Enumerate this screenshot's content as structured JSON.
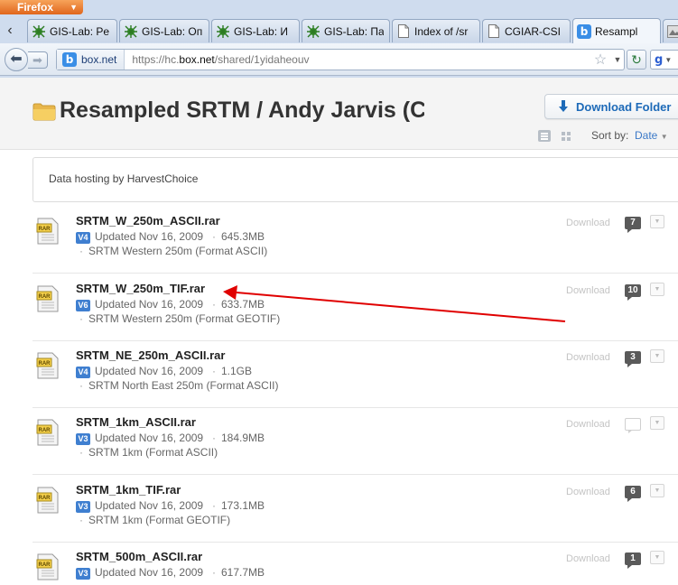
{
  "browser": {
    "app_button_label": "Firefox",
    "tabs": [
      {
        "title": "GIS-Lab: Pe",
        "icon": "gis-lab-favicon",
        "active": false
      },
      {
        "title": "GIS-Lab: Оп",
        "icon": "gis-lab-favicon",
        "active": false
      },
      {
        "title": "GIS-Lab: И",
        "icon": "gis-lab-favicon",
        "active": false
      },
      {
        "title": "GIS-Lab: Па",
        "icon": "gis-lab-favicon",
        "active": false
      },
      {
        "title": "Index of /sr",
        "icon": "page-icon",
        "active": false
      },
      {
        "title": "CGIAR-CSI",
        "icon": "page-icon",
        "active": false
      },
      {
        "title": "Resampl",
        "icon": "box-favicon",
        "active": true
      }
    ],
    "site_identity": "box.net",
    "url_prefix": "https://hc.",
    "url_domain": "box.net",
    "url_path": "/shared/1yidaheouv",
    "search_engine_logo": "g"
  },
  "page": {
    "folder_title": "Resampled SRTM / Andy Jarvis (CIA",
    "download_folder_label": "Download Folder",
    "sort_label": "Sort by:",
    "sort_value": "Date",
    "description": "Data hosting by HarvestChoice",
    "download_label": "Download",
    "files": [
      {
        "name": "SRTM_W_250m_ASCII.rar",
        "version": "V4",
        "updated": "Updated Nov 16, 2009",
        "size": "645.3MB",
        "description": "SRTM Western 250m (Format ASCII)",
        "comments": "7"
      },
      {
        "name": "SRTM_W_250m_TIF.rar",
        "version": "V6",
        "updated": "Updated Nov 16, 2009",
        "size": "633.7MB",
        "description": "SRTM Western 250m (Format GEOTIF)",
        "comments": "10"
      },
      {
        "name": "SRTM_NE_250m_ASCII.rar",
        "version": "V4",
        "updated": "Updated Nov 16, 2009",
        "size": "1.1GB",
        "description": "SRTM North East 250m (Format ASCII)",
        "comments": "3"
      },
      {
        "name": "SRTM_1km_ASCII.rar",
        "version": "V3",
        "updated": "Updated Nov 16, 2009",
        "size": "184.9MB",
        "description": "SRTM 1km (Format ASCII)",
        "comments": ""
      },
      {
        "name": "SRTM_1km_TIF.rar",
        "version": "V3",
        "updated": "Updated Nov 16, 2009",
        "size": "173.1MB",
        "description": "SRTM 1km (Format GEOTIF)",
        "comments": "6"
      },
      {
        "name": "SRTM_500m_ASCII.rar",
        "version": "V3",
        "updated": "Updated Nov 16, 2009",
        "size": "617.7MB",
        "description": "",
        "comments": "1"
      }
    ]
  },
  "colors": {
    "accent_blue": "#1d6ab8",
    "version_badge": "#3f7fd0",
    "annotation_arrow": "#e00000",
    "firefox_orange": "#e8731f"
  }
}
